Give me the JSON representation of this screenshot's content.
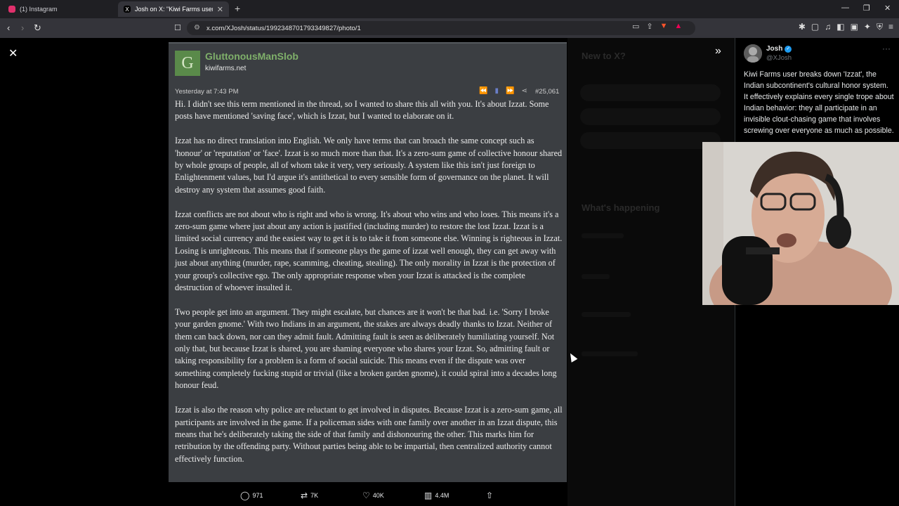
{
  "browser": {
    "tabs": [
      {
        "title": "(1) Instagram",
        "favicon_color": "#e1306c"
      },
      {
        "title": "Josh on X: \"Kiwi Farms user breaks",
        "favicon_color": "#ffffff"
      }
    ],
    "new_tab": "+",
    "url": "x.com/XJosh/status/1992348701793349827/photo/1"
  },
  "post": {
    "avatar_letter": "G",
    "poster": "GluttonousManSlob",
    "site": "kiwifarms.net",
    "date": "Yesterday at 7:43 PM",
    "number": "#25,061",
    "paragraphs": [
      "Hi. I didn't see this term mentioned in the thread, so I wanted to share this all with you. It's about Izzat. Some posts have mentioned 'saving face', which is Izzat, but I wanted to elaborate on it.",
      "Izzat has no direct translation into English. We only have terms that can broach the same concept such as 'honour' or 'reputation' or 'face'. Izzat is so much more than that. It's a zero-sum game of collective honour shared by whole groups of people, all of whom take it very, very seriously. A system like this isn't just foreign to Enlightenment values, but I'd argue it's antithetical to every sensible form of governance on the planet. It will destroy any system that assumes good faith.",
      "Izzat conflicts are not about who is right and who is wrong. It's about who wins and who loses. This means it's a zero-sum game where just about any action is justified (including murder) to restore the lost Izzat. Izzat is a limited social currency and the easiest way to get it is to take it from someone else. Winning is righteous in Izzat. Losing is unrighteous. This means that if someone plays the game of izzat well enough, they can get away with just about anything (murder, rape, scamming, cheating, stealing). The only morality in Izzat is the protection of your group's collective ego. The only appropriate response when your Izzat is attacked is the complete destruction of whoever insulted it.",
      "Two people get into an argument. They might escalate, but chances are it won't be that bad. i.e. 'Sorry I broke your garden gnome.' With two Indians in an argument, the stakes are always deadly thanks to Izzat. Neither of them can back down, nor can they admit fault. Admitting fault is seen as deliberately humiliating yourself. Not only that, but because Izzat is shared, you are shaming everyone who shares your Izzat. So, admitting fault or taking responsibility for a problem is a form of social suicide. This means even if the dispute was over something completely fucking stupid or trivial (like a broken garden gnome), it could spiral into a decades long honour feud.",
      "Izzat is also the reason why police are reluctant to get involved in disputes. Because Izzat is a zero-sum game, all participants are involved in the game. If a policeman sides with one family over another in an Izzat dispute, this means that he's deliberately taking the side of that family and dishonouring the other. This marks him for retribution by the offending party. Without parties being able to be impartial, then centralized authority cannot effectively function."
    ]
  },
  "actions": {
    "replies": "971",
    "reposts": "7K",
    "likes": "40K",
    "views": "4.4M"
  },
  "tweet": {
    "name": "Josh",
    "handle": "@XJosh",
    "text": "Kiwi Farms user breaks down 'Izzat', the Indian subcontinent's cultural honor system. It effectively explains every single trope about Indian behavior: they all participate in an invisible clout-chasing game that involves screwing over everyone as much as possible."
  },
  "background": {
    "new_to_x": "New to X?",
    "whats_happening": "What's happening"
  }
}
